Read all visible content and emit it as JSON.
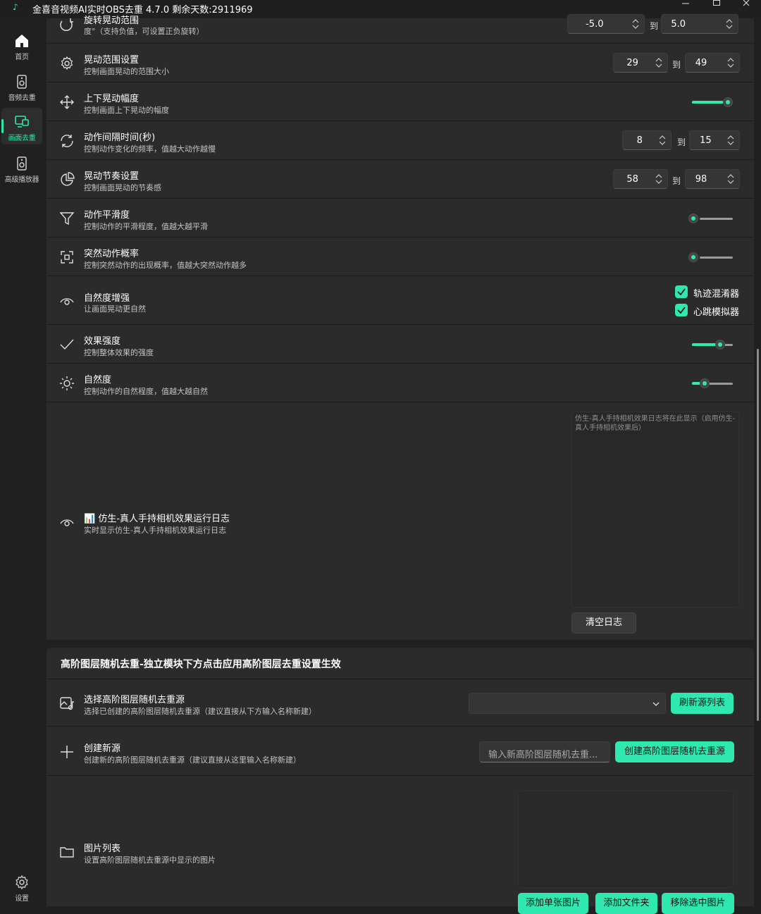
{
  "window": {
    "title": "金喜音视频AI实时OBS去重 4.7.0  剩余天数:2911969"
  },
  "accent": "#2ee8b0",
  "sidebar": {
    "items": [
      {
        "label": "首页",
        "icon": "home-icon"
      },
      {
        "label": "音频去重",
        "icon": "speaker-icon"
      },
      {
        "label": "画面去重",
        "icon": "screen-icon",
        "active": true
      },
      {
        "label": "高级播放器",
        "icon": "player-icon"
      }
    ],
    "settings_label": "设置"
  },
  "rows": {
    "rotation": {
      "title": "旋转晃动范围",
      "desc": "度°（支持负值，可设置正负旋转）",
      "min": "-5.0",
      "max": "5.0",
      "to": "到"
    },
    "shake_range": {
      "title": "晃动范围设置",
      "desc": "控制画面晃动的范围大小",
      "min": "29",
      "max": "49",
      "to": "到"
    },
    "vertical_amp": {
      "title": "上下晃动幅度",
      "desc": "控制画面上下晃动的幅度",
      "level": 1.0
    },
    "interval": {
      "title": "动作间隔时间(秒)",
      "desc": "控制动作变化的频率，值越大动作越慢",
      "min": "8",
      "max": "15",
      "to": "到"
    },
    "rhythm": {
      "title": "晃动节奏设置",
      "desc": "控制画面晃动的节奏感",
      "min": "58",
      "max": "98",
      "to": "到"
    },
    "smoothness": {
      "title": "动作平滑度",
      "desc": "控制动作的平滑程度，值越大越平滑",
      "level": 0.0
    },
    "sudden": {
      "title": "突然动作概率",
      "desc": "控制突然动作的出现概率，值越大突然动作越多",
      "level": 0.0
    },
    "natural_boost": {
      "title": "自然度增强",
      "desc": "让画面晃动更自然",
      "check1": "轨迹混淆器",
      "check2": "心跳模拟器"
    },
    "effect_strength": {
      "title": "效果强度",
      "desc": "控制整体效果的强度",
      "level": 0.75
    },
    "naturalness": {
      "title": "自然度",
      "desc": "控制动作的自然程度，值越大越自然",
      "level": 0.25
    },
    "log": {
      "title": "📊 仿生-真人手持相机效果运行日志",
      "desc": "实时显示仿生-真人手持相机效果运行日志",
      "placeholder": "仿生-真人手持相机效果日志将在此显示（启用仿生-真人手持相机效果后）",
      "clear_label": "清空日志"
    }
  },
  "layer_section": {
    "header": "高阶图层随机去重-独立模块下方点击应用高阶图层去重设置生效",
    "select_source": {
      "title": "选择高阶图层随机去重源",
      "desc": "选择已创建的高阶图层随机去重源（建议直接从下方输入名称新建）",
      "value": "",
      "refresh_label": "刷新源列表"
    },
    "create_source": {
      "title": "创建新源",
      "desc": "创建新的高阶图层随机去重源（建议直接从这里输入名称新建）",
      "placeholder": "输入新高阶图层随机去重...",
      "create_label": "创建高阶图层随机去重源"
    },
    "image_list": {
      "title": "图片列表",
      "desc": "设置高阶图层随机去重源中显示的图片",
      "add_single": "添加单张图片",
      "add_folder": "添加文件夹",
      "remove_selected": "移除选中图片"
    }
  }
}
